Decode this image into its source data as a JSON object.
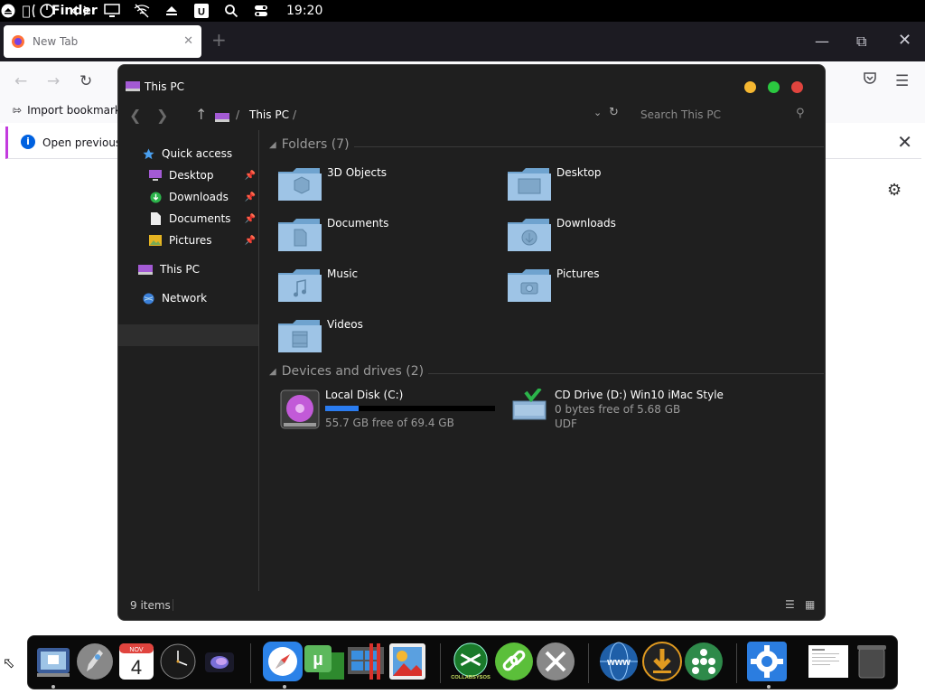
{
  "menubar": {
    "app_name": "Finder",
    "clock": "19:20"
  },
  "firefox": {
    "tab_title": "New Tab",
    "bookmarks": {
      "import_label": "Import bookmarks..."
    },
    "notification": {
      "text": "Open previous ta"
    }
  },
  "explorer": {
    "window_title": "This PC",
    "address": {
      "crumb": "This PC",
      "search_placeholder": "Search This PC"
    },
    "sidebar": {
      "quick_access": "Quick access",
      "pinned": [
        {
          "label": "Desktop",
          "icon": "desktop-icon"
        },
        {
          "label": "Downloads",
          "icon": "downloads-icon"
        },
        {
          "label": "Documents",
          "icon": "documents-icon"
        },
        {
          "label": "Pictures",
          "icon": "pictures-icon"
        }
      ],
      "this_pc": "This PC",
      "network": "Network"
    },
    "folders_header": "Folders (7)",
    "folders": [
      "3D Objects",
      "Desktop",
      "Documents",
      "Downloads",
      "Music",
      "Pictures",
      "Videos"
    ],
    "devices_header": "Devices and drives (2)",
    "drives": [
      {
        "name": "Local Disk (C:)",
        "free_text": "55.7 GB free of 69.4 GB",
        "used_fraction": 0.197
      },
      {
        "name": "CD Drive (D:) Win10 iMac Style",
        "free_text": "0 bytes free of 5.68 GB",
        "fs": "UDF"
      }
    ],
    "status": {
      "items_count": "9 items"
    }
  },
  "dock": {
    "calendar_month": "NOV",
    "calendar_day": "4",
    "apps": [
      "finder",
      "launchpad",
      "calendar",
      "clock",
      "siri",
      "safari",
      "utorrent",
      "windows-apps",
      "photos",
      "collabsysos",
      "link",
      "system-tools",
      "www",
      "downloader",
      "community",
      "settings",
      "document",
      "trash"
    ],
    "labels": {
      "collab": "COLLABSYSOS"
    }
  },
  "colors": {
    "accent_blue": "#2a7cf0",
    "close_red": "#e0443e",
    "min_yellow": "#f5b731",
    "max_green": "#2bc840",
    "folder_blue": "#8db8de"
  }
}
